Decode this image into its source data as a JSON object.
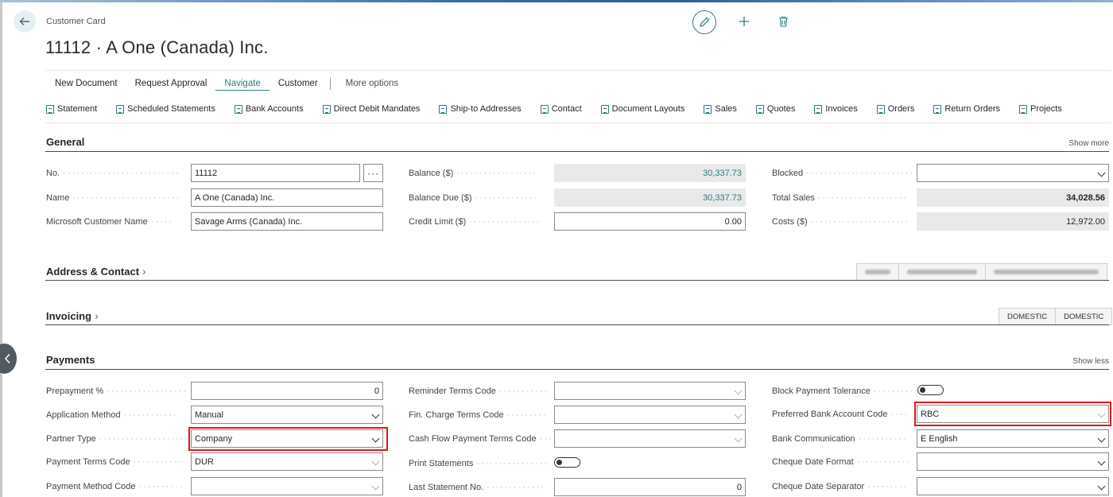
{
  "header": {
    "breadcrumb": "Customer Card",
    "title": "11112 · A One (Canada) Inc."
  },
  "actions": {
    "items": [
      "New Document",
      "Request Approval",
      "Navigate",
      "Customer"
    ],
    "active": "Navigate",
    "more": "More options"
  },
  "nav": {
    "items": [
      "Statement",
      "Scheduled Statements",
      "Bank Accounts",
      "Direct Debit Mandates",
      "Ship-to Addresses",
      "Contact",
      "Document Layouts",
      "Sales",
      "Quotes",
      "Invoices",
      "Orders",
      "Return Orders",
      "Projects"
    ]
  },
  "general": {
    "title": "General",
    "show_link": "Show more",
    "no_label": "No.",
    "no_value": "11112",
    "name_label": "Name",
    "name_value": "A One (Canada) Inc.",
    "ms_label": "Microsoft Customer Name",
    "ms_value": "Savage Arms (Canada) Inc.",
    "balance_label": "Balance ($)",
    "balance_value": "30,337.73",
    "balance_due_label": "Balance Due ($)",
    "balance_due_value": "30,337.73",
    "credit_label": "Credit Limit ($)",
    "credit_value": "0.00",
    "blocked_label": "Blocked",
    "blocked_value": "",
    "total_sales_label": "Total Sales",
    "total_sales_value": "34,028.56",
    "costs_label": "Costs ($)",
    "costs_value": "12,972.00"
  },
  "address": {
    "title": "Address & Contact"
  },
  "invoicing": {
    "title": "Invoicing",
    "tags": [
      "DOMESTIC",
      "DOMESTIC"
    ]
  },
  "payments": {
    "title": "Payments",
    "show_link": "Show less",
    "prepay_label": "Prepayment %",
    "prepay_value": "0",
    "appmethod_label": "Application Method",
    "appmethod_value": "Manual",
    "partner_label": "Partner Type",
    "partner_value": "Company",
    "terms_label": "Payment Terms Code",
    "terms_value": "DUR",
    "method_label": "Payment Method Code",
    "method_value": "",
    "reminder_label": "Reminder Terms Code",
    "reminder_value": "",
    "finch_label": "Fin. Charge Terms Code",
    "finch_value": "",
    "cashflow_label": "Cash Flow Payment Terms Code",
    "cashflow_value": "",
    "print_label": "Print Statements",
    "print_on": false,
    "laststmt_label": "Last Statement No.",
    "laststmt_value": "0",
    "blocktol_label": "Block Payment Tolerance",
    "blocktol_on": false,
    "prefbank_label": "Preferred Bank Account Code",
    "prefbank_value": "RBC",
    "bankcomm_label": "Bank Communication",
    "bankcomm_value": "E English",
    "chqfmt_label": "Cheque Date Format",
    "chqfmt_value": "",
    "chqsep_label": "Cheque Date Separator",
    "chqsep_value": ""
  },
  "colors": {
    "accent": "#2e7a86",
    "highlight": "#e01616"
  }
}
